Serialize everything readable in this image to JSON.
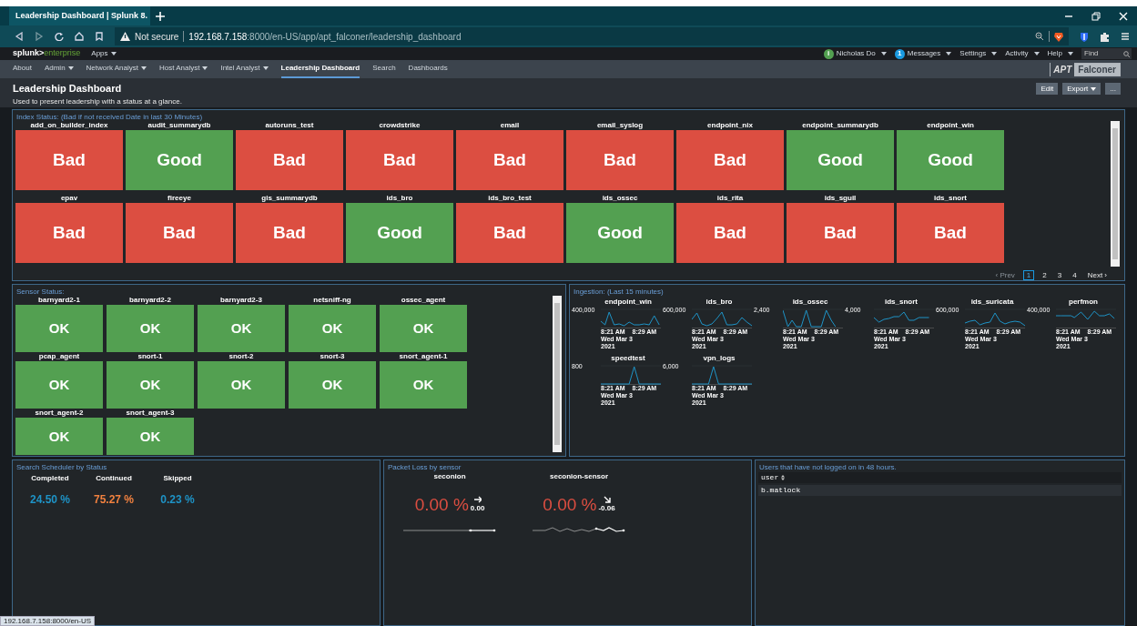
{
  "browser": {
    "tab_title": "Leadership Dashboard | Splunk 8.",
    "address_warning": "Not secure",
    "url": "**192.168.7.158**:8000/en-US/app/apt_falconer/leadership_dashboard"
  },
  "splunk_bar": {
    "logo_primary": "splunk>",
    "logo_secondary": "enterprise",
    "apps": "Apps",
    "menus": [
      {
        "label": "Nicholas Do",
        "color": "#53a051",
        "dot_text": "i"
      },
      {
        "label": "Messages",
        "color": "#1a9ae0",
        "dot_text": "1"
      },
      {
        "label": "Settings"
      },
      {
        "label": "Activity"
      },
      {
        "label": "Help"
      }
    ],
    "find_placeholder": "Find"
  },
  "nav": [
    {
      "label": "About",
      "menu": false,
      "selected": false
    },
    {
      "label": "Admin",
      "menu": true,
      "selected": false
    },
    {
      "label": "Network Analyst",
      "menu": true,
      "selected": false
    },
    {
      "label": "Host Analyst",
      "menu": true,
      "selected": false
    },
    {
      "label": "Intel Analyst",
      "menu": true,
      "selected": false
    },
    {
      "label": "Leadership Dashboard",
      "menu": false,
      "selected": true
    },
    {
      "label": "Search",
      "menu": false,
      "selected": false
    },
    {
      "label": "Dashboards",
      "menu": false,
      "selected": false
    }
  ],
  "app_logo": {
    "badge": "APT",
    "name": "Falconer"
  },
  "dashboard": {
    "title": "Leadership Dashboard",
    "description": "Used to present leadership with a status at a glance.",
    "buttons": [
      {
        "label": "Edit",
        "menu": false
      },
      {
        "label": "Export",
        "menu": true
      },
      {
        "label": "...",
        "menu": false
      }
    ]
  },
  "index_status": {
    "title": "Index Status: (Bad if not received Date in last 30 Minutes)",
    "tiles": [
      {
        "name": "add_on_builder_index",
        "status": "Bad",
        "color": "#dc4e41"
      },
      {
        "name": "audit_summarydb",
        "status": "Good",
        "color": "#53a051"
      },
      {
        "name": "autoruns_test",
        "status": "Bad",
        "color": "#dc4e41"
      },
      {
        "name": "crowdstrike",
        "status": "Bad",
        "color": "#dc4e41"
      },
      {
        "name": "email",
        "status": "Bad",
        "color": "#dc4e41"
      },
      {
        "name": "email_syslog",
        "status": "Bad",
        "color": "#dc4e41"
      },
      {
        "name": "endpoint_nix",
        "status": "Bad",
        "color": "#dc4e41"
      },
      {
        "name": "endpoint_summarydb",
        "status": "Good",
        "color": "#53a051"
      },
      {
        "name": "endpoint_win",
        "status": "Good",
        "color": "#53a051"
      },
      {
        "name": "epav",
        "status": "Bad",
        "color": "#dc4e41"
      },
      {
        "name": "fireeye",
        "status": "Bad",
        "color": "#dc4e41"
      },
      {
        "name": "gis_summarydb",
        "status": "Bad",
        "color": "#dc4e41"
      },
      {
        "name": "ids_bro",
        "status": "Good",
        "color": "#53a051"
      },
      {
        "name": "ids_bro_test",
        "status": "Bad",
        "color": "#dc4e41"
      },
      {
        "name": "ids_ossec",
        "status": "Good",
        "color": "#53a051"
      },
      {
        "name": "ids_rita",
        "status": "Bad",
        "color": "#dc4e41"
      },
      {
        "name": "ids_sguil",
        "status": "Bad",
        "color": "#dc4e41"
      },
      {
        "name": "ids_snort",
        "status": "Bad",
        "color": "#dc4e41"
      }
    ],
    "pagination": [
      {
        "label": "‹ Prev",
        "disabled": true,
        "selected": false
      },
      {
        "label": "1",
        "disabled": false,
        "selected": true
      },
      {
        "label": "2",
        "disabled": false,
        "selected": false
      },
      {
        "label": "3",
        "disabled": false,
        "selected": false
      },
      {
        "label": "4",
        "disabled": false,
        "selected": false
      },
      {
        "label": "Next ›",
        "disabled": false,
        "selected": false
      }
    ]
  },
  "sensor_status": {
    "title": "Sensor Status:",
    "tiles": [
      {
        "name": "barnyard2-1",
        "status": "OK",
        "color": "#53a051"
      },
      {
        "name": "barnyard2-2",
        "status": "OK",
        "color": "#53a051"
      },
      {
        "name": "barnyard2-3",
        "status": "OK",
        "color": "#53a051"
      },
      {
        "name": "netsniff-ng",
        "status": "OK",
        "color": "#53a051"
      },
      {
        "name": "ossec_agent",
        "status": "OK",
        "color": "#53a051"
      },
      {
        "name": "pcap_agent",
        "status": "OK",
        "color": "#53a051"
      },
      {
        "name": "snort-1",
        "status": "OK",
        "color": "#53a051"
      },
      {
        "name": "snort-2",
        "status": "OK",
        "color": "#53a051"
      },
      {
        "name": "snort-3",
        "status": "OK",
        "color": "#53a051"
      },
      {
        "name": "snort_agent-1",
        "status": "OK",
        "color": "#53a051"
      },
      {
        "name": "snort_agent-2",
        "status": "OK",
        "color": "#53a051"
      },
      {
        "name": "snort_agent-3",
        "status": "OK",
        "color": "#53a051"
      }
    ]
  },
  "ingestion": {
    "title": "Ingestion: (Last 15 minutes)",
    "charts": [
      {
        "title": "endpoint_win",
        "y_tick": "400,000",
        "x_ticks": [
          "8:21 AM",
          "8:29 AM"
        ],
        "date": [
          "Wed Mar 3",
          "2021"
        ]
      },
      {
        "title": "ids_bro",
        "y_tick": "600,000",
        "x_ticks": [
          "8:21 AM",
          "8:29 AM"
        ],
        "date": [
          "Wed Mar 3",
          "2021"
        ]
      },
      {
        "title": "ids_ossec",
        "y_tick": "2,400",
        "x_ticks": [
          "8:21 AM",
          "8:29 AM"
        ],
        "date": [
          "Wed Mar 3",
          "2021"
        ]
      },
      {
        "title": "ids_snort",
        "y_tick": "4,000",
        "x_ticks": [
          "8:21 AM",
          "8:29 AM"
        ],
        "date": [
          "Wed Mar 3",
          "2021"
        ]
      },
      {
        "title": "ids_suricata",
        "y_tick": "600,000",
        "x_ticks": [
          "8:21 AM",
          "8:29 AM"
        ],
        "date": [
          "Wed Mar 3",
          "2021"
        ]
      },
      {
        "title": "perfmon",
        "y_tick": "400,000",
        "x_ticks": [
          "8:21 AM",
          "8:29 AM"
        ],
        "date": [
          "Wed Mar 3",
          "2021"
        ]
      },
      {
        "title": "speedtest",
        "y_tick": "800",
        "x_ticks": [
          "8:21 AM",
          "8:29 AM"
        ],
        "date": [
          "Wed Mar 3",
          "2021"
        ]
      },
      {
        "title": "vpn_logs",
        "y_tick": "6,000",
        "x_ticks": [
          "8:21 AM",
          "8:29 AM"
        ],
        "date": [
          "Wed Mar 3",
          "2021"
        ]
      }
    ]
  },
  "scheduler": {
    "title": "Search Scheduler by Status",
    "items": [
      {
        "label": "Completed",
        "value": "24.50 %",
        "color": "#1e93c6"
      },
      {
        "label": "Continued",
        "value": "75.27 %",
        "color": "#f1813f"
      },
      {
        "label": "Skipped",
        "value": "0.23 %",
        "color": "#1e93c6"
      }
    ]
  },
  "packet_loss": {
    "title": "Packet Loss by sensor",
    "items": [
      {
        "label": "seconion",
        "value": "0.00 %",
        "delta": "0.00",
        "kind": "flat"
      },
      {
        "label": "seconion-sensor",
        "value": "0.00 %",
        "delta": "-0.06",
        "kind": "down"
      }
    ]
  },
  "users": {
    "title": "Users that have not logged on in 48 hours.",
    "columns": [
      "user"
    ],
    "rows": [
      [
        "b.matlock"
      ]
    ]
  },
  "status_url": "192.168.7.158:8000/en-US"
}
